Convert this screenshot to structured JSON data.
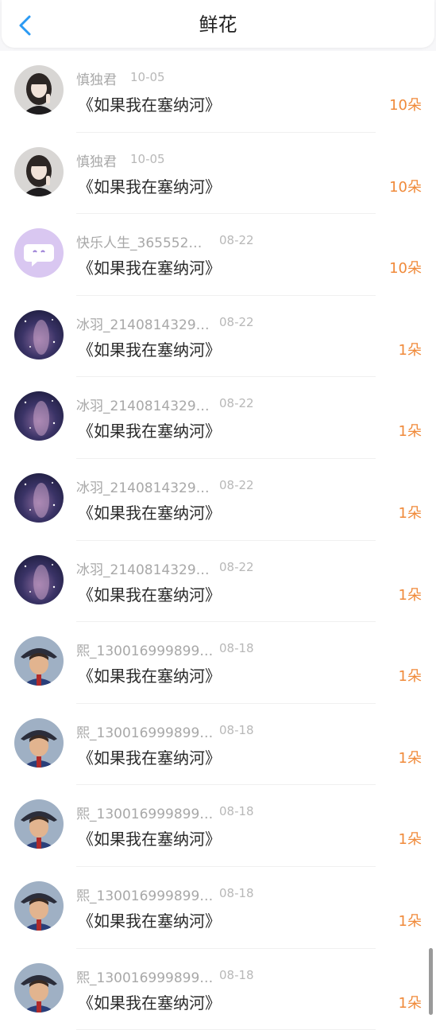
{
  "header": {
    "title": "鲜花",
    "back_icon": "chevron-left-icon",
    "accent": "#2b9af3"
  },
  "colors": {
    "count": "#f08a3a"
  },
  "items": [
    {
      "avatar": "girl",
      "name": "慎独君",
      "date": "10-05",
      "book": "《如果我在塞纳河》",
      "count": "10朵"
    },
    {
      "avatar": "girl",
      "name": "慎独君",
      "date": "10-05",
      "book": "《如果我在塞纳河》",
      "count": "10朵"
    },
    {
      "avatar": "bubble",
      "name": "快乐人生_365552…",
      "date": "08-22",
      "book": "《如果我在塞纳河》",
      "count": "10朵"
    },
    {
      "avatar": "night",
      "name": "冰羽_2140814329…",
      "date": "08-22",
      "book": "《如果我在塞纳河》",
      "count": "1朵"
    },
    {
      "avatar": "night",
      "name": "冰羽_2140814329…",
      "date": "08-22",
      "book": "《如果我在塞纳河》",
      "count": "1朵"
    },
    {
      "avatar": "night",
      "name": "冰羽_2140814329…",
      "date": "08-22",
      "book": "《如果我在塞纳河》",
      "count": "1朵"
    },
    {
      "avatar": "night",
      "name": "冰羽_2140814329…",
      "date": "08-22",
      "book": "《如果我在塞纳河》",
      "count": "1朵"
    },
    {
      "avatar": "anime",
      "name": "熙_130016999899…",
      "date": "08-18",
      "book": "《如果我在塞纳河》",
      "count": "1朵"
    },
    {
      "avatar": "anime",
      "name": "熙_130016999899…",
      "date": "08-18",
      "book": "《如果我在塞纳河》",
      "count": "1朵"
    },
    {
      "avatar": "anime",
      "name": "熙_130016999899…",
      "date": "08-18",
      "book": "《如果我在塞纳河》",
      "count": "1朵"
    },
    {
      "avatar": "anime",
      "name": "熙_130016999899…",
      "date": "08-18",
      "book": "《如果我在塞纳河》",
      "count": "1朵"
    },
    {
      "avatar": "anime",
      "name": "熙_130016999899…",
      "date": "08-18",
      "book": "《如果我在塞纳河》",
      "count": "1朵"
    }
  ]
}
